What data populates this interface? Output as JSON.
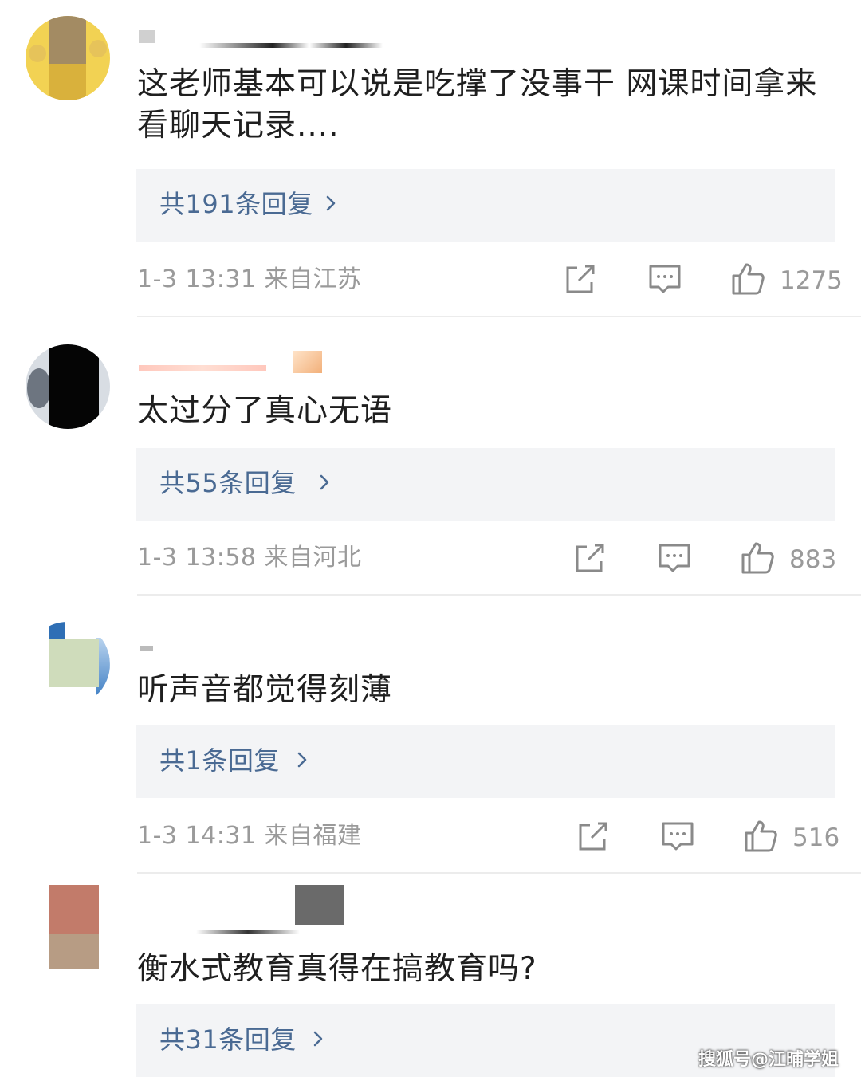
{
  "comments": [
    {
      "text": "这老师基本可以说是吃撑了没事干 网课时间拿来看聊天记录....",
      "replies_label": "共191条回复",
      "meta": "1-3 13:31 来自江苏",
      "likes": "1275"
    },
    {
      "text": "太过分了真心无语",
      "replies_label": "共55条回复",
      "meta": "1-3 13:58 来自河北",
      "likes": "883"
    },
    {
      "text": "听声音都觉得刻薄",
      "replies_label": "共1条回复",
      "meta": "1-3 14:31 来自福建",
      "likes": "516"
    },
    {
      "text": "衡水式教育真得在搞教育吗?",
      "replies_label": "共31条回复"
    }
  ],
  "watermark": "搜狐号@江晡学姐",
  "icons": [
    "share-icon",
    "comment-icon",
    "like-icon",
    "chevron-right-icon"
  ],
  "colors": {
    "reply_link": "#4a6a93",
    "reply_bg": "#f3f4f6",
    "meta_gray": "#9a9a9a",
    "divider": "#ececec"
  }
}
